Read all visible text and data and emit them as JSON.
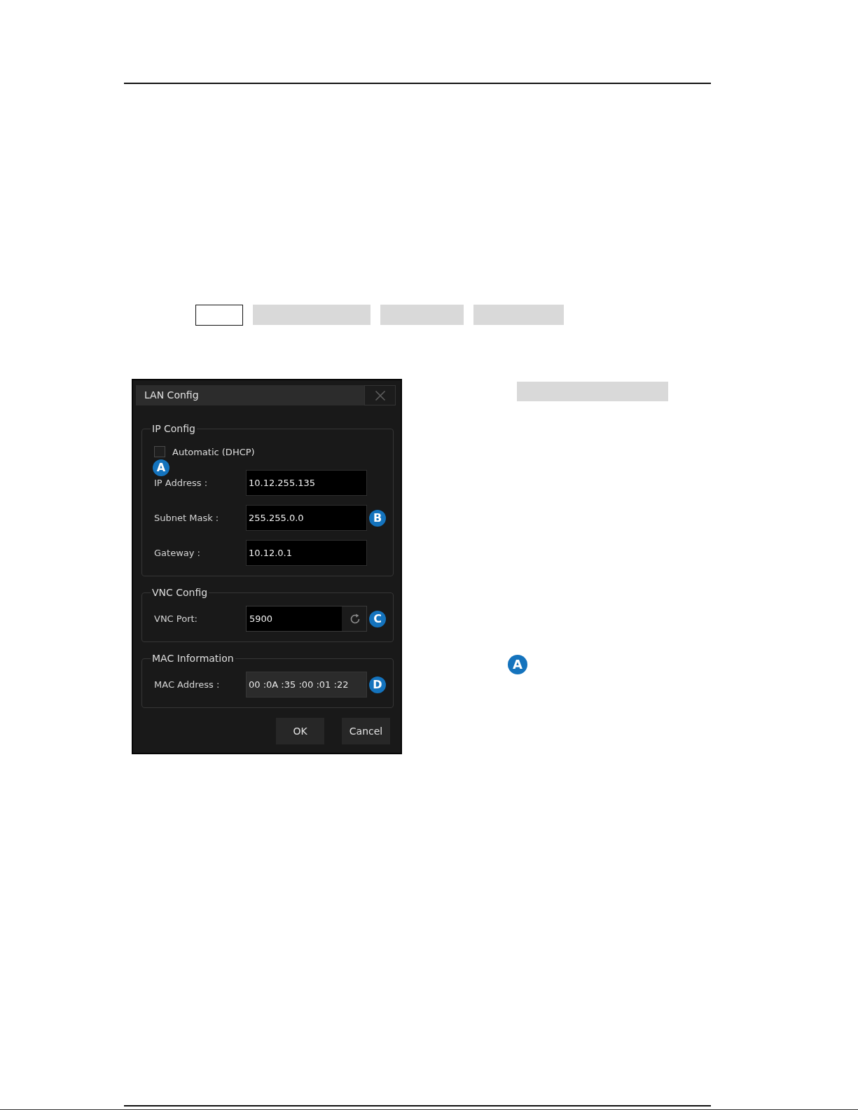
{
  "page": {
    "key_row": [
      {
        "kind": "outlined"
      },
      {
        "kind": "shaded"
      },
      {
        "kind": "shaded"
      },
      {
        "kind": "shaded"
      }
    ],
    "side_bar": {
      "kind": "shaded"
    },
    "side_callout": "A"
  },
  "dialog": {
    "title": "LAN Config",
    "groups": [
      {
        "legend": "IP Config",
        "checkbox": {
          "label": "Automatic (DHCP)",
          "checked": false
        },
        "callout": "A",
        "fields": [
          {
            "kind": "input",
            "label": "IP Address :",
            "value": "10.12.255.135"
          },
          {
            "kind": "input",
            "label": "Subnet Mask :",
            "value": "255.255.0.0",
            "callout": "B"
          },
          {
            "kind": "input",
            "label": "Gateway :",
            "value": "10.12.0.1"
          }
        ]
      },
      {
        "legend": "VNC Config",
        "fields": [
          {
            "kind": "reset_input",
            "label": "VNC Port:",
            "value": "5900",
            "callout": "C"
          }
        ]
      },
      {
        "legend": "MAC Information",
        "fields": [
          {
            "kind": "display",
            "label": "MAC Address :",
            "value": "00 :0A :35 :00 :01 :22",
            "callout": "D"
          }
        ]
      }
    ],
    "buttons": [
      "OK",
      "Cancel"
    ]
  }
}
